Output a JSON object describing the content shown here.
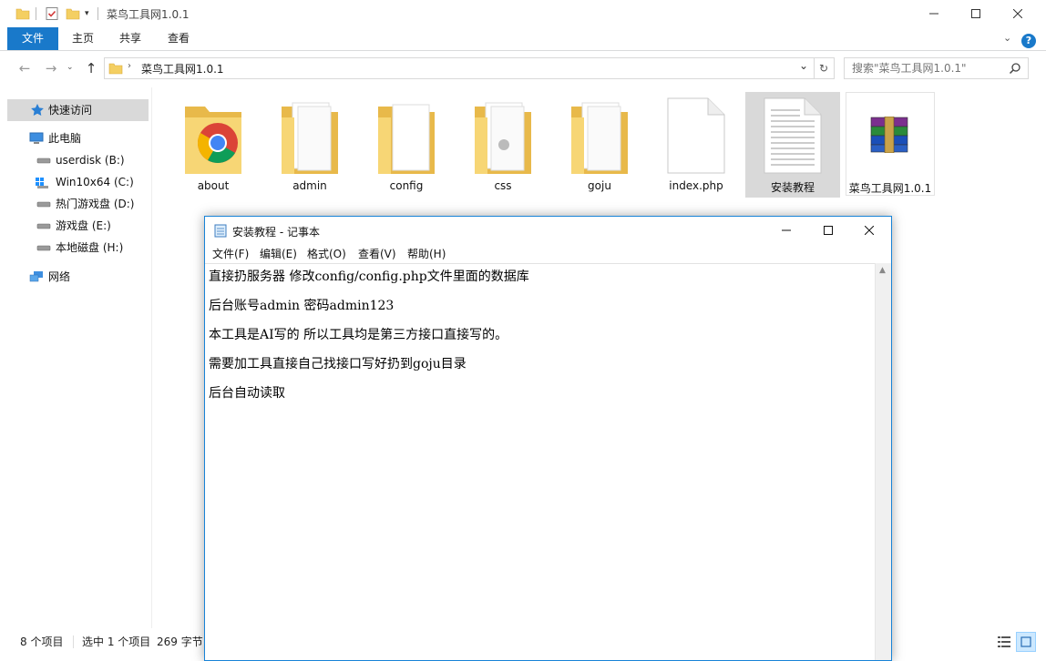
{
  "explorer": {
    "title": "菜鸟工具网1.0.1",
    "tabs": [
      "文件",
      "主页",
      "共享",
      "查看"
    ],
    "address": "菜鸟工具网1.0.1",
    "search_placeholder": "搜索\"菜鸟工具网1.0.1\"",
    "nav": {
      "quick_access": "快速访问",
      "this_pc": "此电脑",
      "drives": [
        "userdisk (B:)",
        "Win10x64 (C:)",
        "热门游戏盘 (D:)",
        "游戏盘 (E:)",
        "本地磁盘 (H:)"
      ],
      "network": "网络"
    },
    "files": [
      {
        "name": "about",
        "icon": "folder-chrome-icon"
      },
      {
        "name": "admin",
        "icon": "folder-icon"
      },
      {
        "name": "config",
        "icon": "folder-icon"
      },
      {
        "name": "css",
        "icon": "folder-icon"
      },
      {
        "name": "goju",
        "icon": "folder-icon"
      },
      {
        "name": "index.php",
        "icon": "php-file-icon"
      },
      {
        "name": "安装教程",
        "icon": "text-file-icon"
      },
      {
        "name": "菜鸟工具网1.0.1",
        "icon": "winrar-icon"
      }
    ],
    "status": {
      "count": "8 个项目",
      "selected": "选中 1 个项目",
      "size": "269 字节"
    }
  },
  "notepad": {
    "title": "安装教程 - 记事本",
    "menu": [
      "文件(F)",
      "编辑(E)",
      "格式(O)",
      "查看(V)",
      "帮助(H)"
    ],
    "lines": [
      "直接扔服务器 修改config/config.php文件里面的数据库",
      "后台账号admin  密码admin123",
      "本工具是AI写的 所以工具均是第三方接口直接写的。",
      "需要加工具直接自己找接口写好扔到goju目录",
      "后台自动读取"
    ]
  },
  "colors": {
    "accent": "#1979ca",
    "folder": "#f4cf62",
    "selection": "#d9d9d9",
    "quick_access_bg": "#cce8ff"
  }
}
